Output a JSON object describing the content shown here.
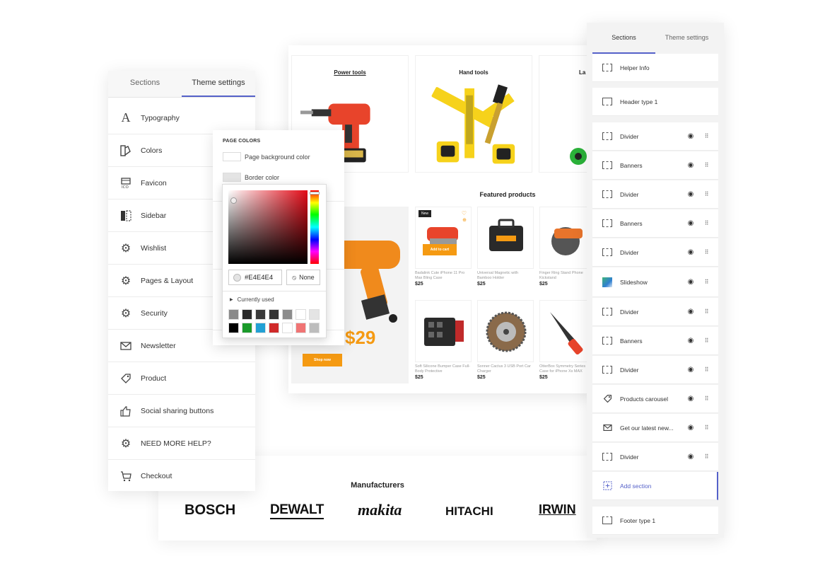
{
  "preview": {
    "categories": [
      {
        "title": "Power tools"
      },
      {
        "title": "Hand tools"
      },
      {
        "title": "La"
      }
    ],
    "featured_title": "Featured products",
    "promo": {
      "price": "$29",
      "button": "Shop now"
    },
    "products": [
      {
        "name": "Badalink Cute iPhone 11 Pro Max Bling Case",
        "price": "$25",
        "badge": "New",
        "cta": "Add to cart"
      },
      {
        "name": "Universal Magnetic with Bamboo Holder",
        "price": "$25"
      },
      {
        "name": "Finger Ring Stand Phone Kickstand",
        "price": "$25"
      },
      {
        "name": "Soft Silicone Bumper Case Full-Body Protective",
        "price": "$25"
      },
      {
        "name": "Sonner Cactus 3 USB Port Car Charger",
        "price": "$25"
      },
      {
        "name": "OtterBox Symmetry Series Case for iPhone Xs MAX",
        "price": "$25"
      }
    ]
  },
  "manufacturers": {
    "title": "Manufacturers",
    "brands": [
      "BOSCH",
      "DEWALT",
      "makita",
      "HITACHI",
      "IRWIN"
    ]
  },
  "theme_panel": {
    "tabs": [
      "Sections",
      "Theme settings"
    ],
    "active_tab": "Theme settings",
    "items": [
      {
        "label": "Typography",
        "icon": "typography-icon"
      },
      {
        "label": "Colors",
        "icon": "colors-icon"
      },
      {
        "label": "Favicon",
        "icon": "favicon-icon"
      },
      {
        "label": "Sidebar",
        "icon": "sidebar-icon"
      },
      {
        "label": "Wishlist",
        "icon": "gear-icon"
      },
      {
        "label": "Pages & Layout",
        "icon": "gear-icon"
      },
      {
        "label": "Security",
        "icon": "gear-icon"
      },
      {
        "label": "Newsletter",
        "icon": "envelope-icon"
      },
      {
        "label": "Product",
        "icon": "tag-icon"
      },
      {
        "label": "Social sharing buttons",
        "icon": "thumbs-up-icon"
      },
      {
        "label": "NEED MORE HELP?",
        "icon": "gear-icon"
      },
      {
        "label": "Checkout",
        "icon": "cart-icon"
      }
    ]
  },
  "page_colors": {
    "title": "PAGE COLORS",
    "rows": [
      {
        "label": "Page background color",
        "color": "#ffffff"
      },
      {
        "label": "Border color",
        "color": "#e4e4e4"
      }
    ]
  },
  "color_picker": {
    "hex": "#E4E4E4",
    "none_label": "None",
    "currently_used_label": "Currently used",
    "swatches": [
      "#8a8a8a",
      "#2a2a2a",
      "#3a3a3a",
      "#333333",
      "#8c8c8c",
      "#ffffff",
      "#e4e4e4",
      "#000000",
      "#1a9a2a",
      "#22a0d4",
      "#d02a2a",
      "#ffffff",
      "#f07474",
      "#bdbdbd"
    ]
  },
  "sections_panel": {
    "tabs": [
      "Sections",
      "Theme settings"
    ],
    "active_tab": "Sections",
    "rows": [
      {
        "label": "Helper Info",
        "icon": "section-icon",
        "controls": false
      },
      {
        "label": "Header type 1",
        "icon": "header-icon",
        "controls": false
      },
      {
        "label": "Divider",
        "icon": "section-icon",
        "controls": true
      },
      {
        "label": "Banners",
        "icon": "section-icon",
        "controls": true
      },
      {
        "label": "Divider",
        "icon": "section-icon",
        "controls": true
      },
      {
        "label": "Banners",
        "icon": "section-icon",
        "controls": true
      },
      {
        "label": "Divider",
        "icon": "section-icon",
        "controls": true
      },
      {
        "label": "Slideshow",
        "icon": "slideshow-thumbnail",
        "controls": true
      },
      {
        "label": "Divider",
        "icon": "section-icon",
        "controls": true
      },
      {
        "label": "Banners",
        "icon": "section-icon",
        "controls": true
      },
      {
        "label": "Divider",
        "icon": "section-icon",
        "controls": true
      },
      {
        "label": "Products carousel",
        "icon": "tag-icon",
        "controls": true
      },
      {
        "label": "Get our latest new...",
        "icon": "envelope-icon",
        "controls": true
      },
      {
        "label": "Divider",
        "icon": "section-icon",
        "controls": true
      },
      {
        "label": "Add section",
        "icon": "add-icon",
        "controls": false
      },
      {
        "label": "Footer type 1",
        "icon": "footer-icon",
        "controls": false
      }
    ]
  },
  "colors": {
    "accent": "#5561c9",
    "brand_orange": "#f59a12"
  }
}
